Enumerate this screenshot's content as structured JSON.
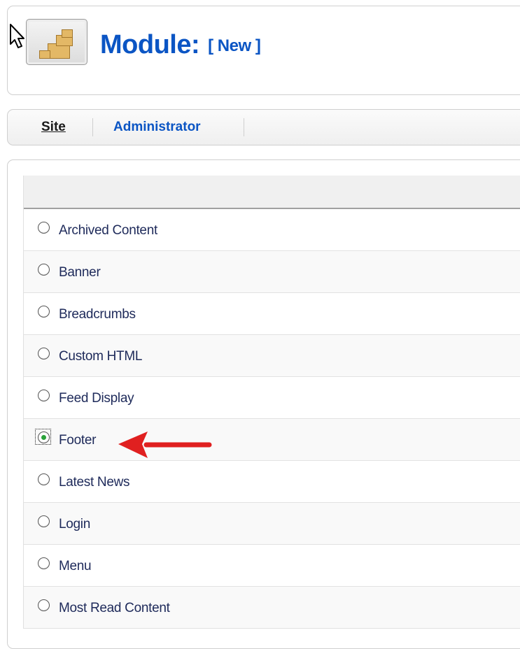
{
  "header": {
    "title": "Module:",
    "subtitle": "[ New ]",
    "icon": "module-icon"
  },
  "tabs": [
    {
      "label": "Site",
      "active": true
    },
    {
      "label": "Administrator",
      "active": false
    }
  ],
  "module_list": {
    "items": [
      {
        "label": "Archived Content",
        "selected": false
      },
      {
        "label": "Banner",
        "selected": false
      },
      {
        "label": "Breadcrumbs",
        "selected": false
      },
      {
        "label": "Custom HTML",
        "selected": false
      },
      {
        "label": "Feed Display",
        "selected": false
      },
      {
        "label": "Footer",
        "selected": true
      },
      {
        "label": "Latest News",
        "selected": false
      },
      {
        "label": "Login",
        "selected": false
      },
      {
        "label": "Menu",
        "selected": false
      },
      {
        "label": "Most Read Content",
        "selected": false
      }
    ],
    "selected_value": "Footer"
  },
  "annotation": {
    "icon": "red-arrow-icon",
    "color": "#e02020"
  },
  "colors": {
    "accent": "#0b55c4",
    "row_text": "#1e2a5a"
  }
}
